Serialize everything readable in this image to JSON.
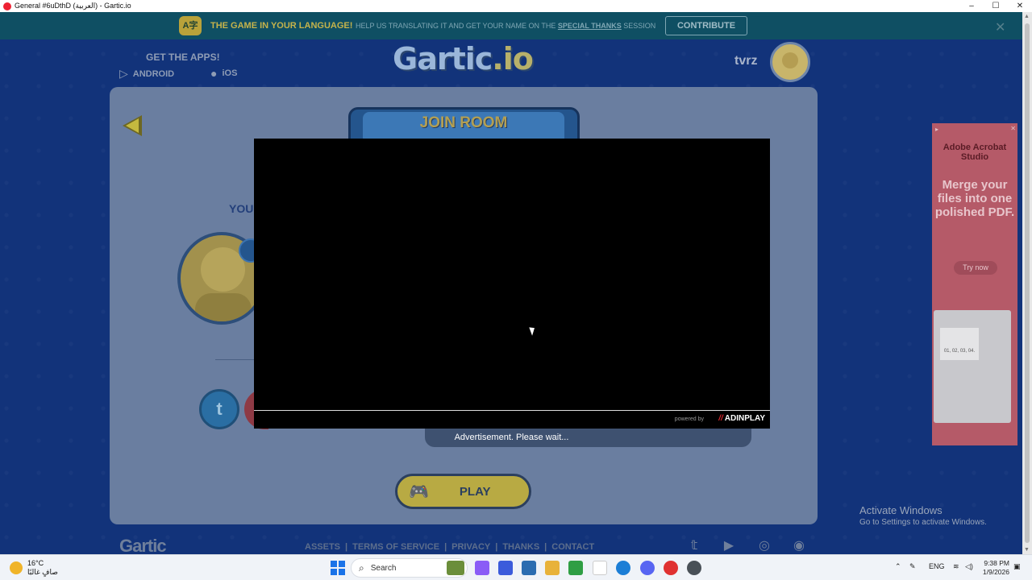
{
  "window": {
    "title": "General #6uDthD (العربية) - Gartic.io",
    "controls": [
      "–",
      "☐",
      "✕"
    ]
  },
  "banner": {
    "icon_text": "A字",
    "bold_text": "THE GAME IN YOUR LANGUAGE!",
    "message_before": "HELP US TRANSLATING IT AND GET YOUR NAME ON THE",
    "message_link": "SPECIAL THANKS",
    "message_after": "SESSION",
    "button": "CONTRIBUTE",
    "close": "✕"
  },
  "header": {
    "apps_title": "GET THE APPS!",
    "android_label": "ANDROID",
    "ios_label": "iOS",
    "logo_main": "Gartic",
    "logo_suffix": ".io",
    "username": "tvrz"
  },
  "room": {
    "title": "JOIN ROOM",
    "you_label": "YOU",
    "twitter_glyph": "t",
    "play_label": "PLAY",
    "ad_wait": "Advertisement. Please wait..."
  },
  "video_ad": {
    "powered_by": "powered by",
    "brand": "ADINPLAY"
  },
  "side_ad": {
    "brand": "Adobe Acrobat Studio",
    "headline": "Merge your files into one polished PDF.",
    "cta": "Try now",
    "doc_text": "01, 02, 03, 04."
  },
  "footer": {
    "logo": "Gartic",
    "links": [
      "ASSETS",
      "TERMS OF SERVICE",
      "PRIVACY",
      "THANKS",
      "CONTACT"
    ],
    "social": [
      "twitter-icon",
      "youtube-icon",
      "instagram-icon",
      "discord-icon"
    ]
  },
  "watermark": {
    "line1": "Activate Windows",
    "line2": "Go to Settings to activate Windows."
  },
  "taskbar": {
    "temperature": "16°C",
    "weather_text": "صافٍ غالبًا",
    "search_label": "Search",
    "language": "ENG",
    "time": "9:38 PM",
    "date": "1/9/2026"
  },
  "colors": {
    "background": "#12337a",
    "banner": "#0f4f63",
    "play_button": "#b8aa43",
    "adinplay_red": "#e0262c"
  }
}
